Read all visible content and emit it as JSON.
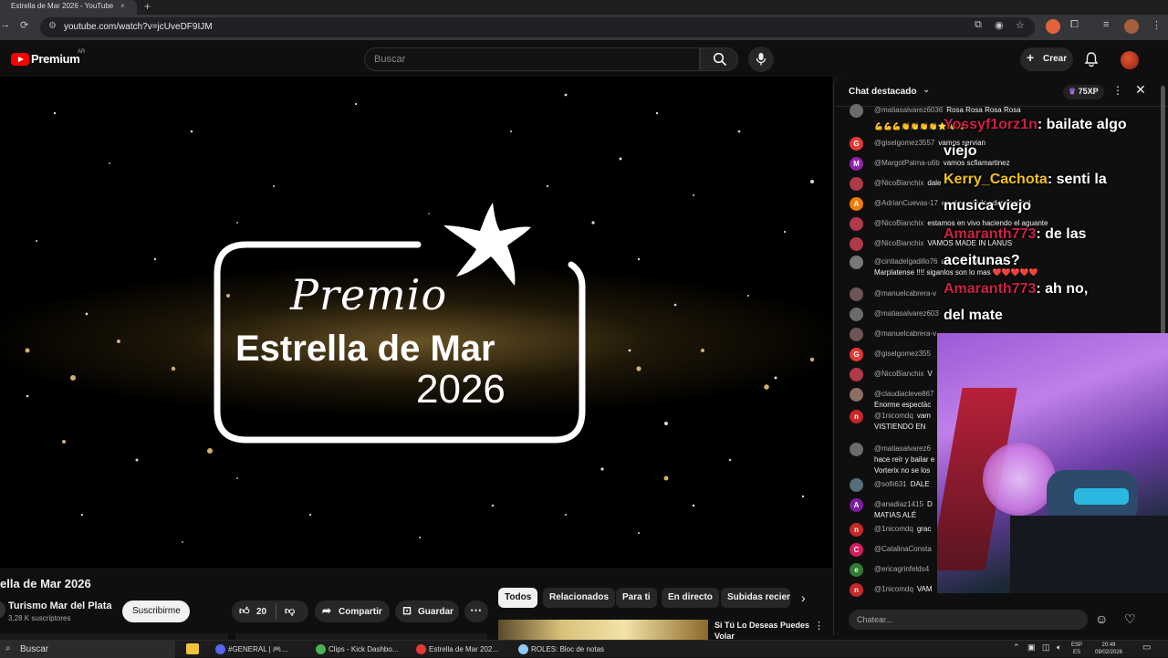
{
  "browser": {
    "tab_title": "Estrella de Mar 2026 - YouTube",
    "tab_close": "×",
    "new_tab": "+",
    "url": "youtube.com/watch?v=jcUveDF9IJM"
  },
  "masthead": {
    "brand": "Premium",
    "country": "AR",
    "search_placeholder": "Buscar",
    "create_label": "Crear"
  },
  "video": {
    "poster": {
      "premio": "Premio",
      "estrella": "Estrella de Mar",
      "year": "2026"
    },
    "title": "ella de Mar 2026",
    "channel": "Turismo Mar del Plata",
    "subscribers": "3,28 K suscriptores",
    "subscribe_label": "Suscribirme",
    "likes": "20",
    "share_label": "Compartir",
    "save_label": "Guardar"
  },
  "chips": [
    "Todos",
    "Relacionados",
    "Para ti",
    "En directo",
    "Subidas recien"
  ],
  "related": {
    "title_line1": "Si Tú Lo Deseas Puedes",
    "title_line2": "Volar"
  },
  "chat": {
    "title": "Chat destacado",
    "xp": "75XP",
    "input_placeholder": "Chatear...",
    "messages": [
      {
        "author": "@matiasalvarez6036",
        "text": "Rosa Rosa Rosa Rosa",
        "initial": "",
        "color": "#6b6b6b"
      },
      {
        "author": "",
        "text": "💪💪💪👏👏👏👏⭐⭐⭐",
        "initial": "",
        "color": "#0f0f0f"
      },
      {
        "author": "@giselgomez3557",
        "text": "vamos servian",
        "initial": "G",
        "color": "#e53935"
      },
      {
        "author": "@MargotPalma-u6b",
        "text": "vamos scfiamartinez",
        "initial": "M",
        "color": "#8e24aa"
      },
      {
        "author": "@NicoBianchix",
        "text": "dale",
        "initial": "",
        "color": "#b03a48"
      },
      {
        "author": "@AdrianCuevas-17",
        "text": "en vivo a todos dominados!",
        "initial": "A",
        "color": "#f57c00"
      },
      {
        "author": "@NicoBianchix",
        "text": "estamos en vivo haciendo el aguante",
        "initial": "",
        "color": "#b03a48"
      },
      {
        "author": "@NicoBianchix",
        "text": "VAMOS MADE IN LANUS",
        "initial": "",
        "color": "#b03a48"
      },
      {
        "author": "@cintiadelgadillo76",
        "text": "armona con Música",
        "initial": "",
        "color": "#777777"
      },
      {
        "author": "",
        "text": "Marplatense !!!! siganlos son lo mas ❤️❤️❤️❤️❤️",
        "initial": "",
        "color": "#0f0f0f"
      },
      {
        "author": "@manuelcabrera-v",
        "text": "",
        "initial": "",
        "color": "#6d5555"
      },
      {
        "author": "@matiasalvarez603",
        "text": "",
        "initial": "",
        "color": "#6b6b6b"
      },
      {
        "author": "@manuelcabrera-v",
        "text": "",
        "initial": "",
        "color": "#6d5555"
      },
      {
        "author": "@giselgomez355",
        "text": "",
        "initial": "G",
        "color": "#e53935"
      },
      {
        "author": "@NicoBianchix",
        "text": "V",
        "initial": "",
        "color": "#b03a48"
      },
      {
        "author": "@claudiacleve867",
        "text": "",
        "initial": "",
        "color": "#8d6e63"
      },
      {
        "author": "",
        "text": "Enorme espectác",
        "initial": "",
        "color": "#0f0f0f"
      },
      {
        "author": "@1nicomdq",
        "text": "vam",
        "initial": "n",
        "color": "#c62828"
      },
      {
        "author": "",
        "text": "VISTIENDO EN",
        "initial": "",
        "color": "#0f0f0f"
      },
      {
        "author": "@matiasalvarez6",
        "text": "",
        "initial": "",
        "color": "#6b6b6b"
      },
      {
        "author": "",
        "text": "hace reír y bailar e",
        "initial": "",
        "color": "#0f0f0f"
      },
      {
        "author": "",
        "text": "Vorterix no se los",
        "initial": "",
        "color": "#0f0f0f"
      },
      {
        "author": "@sofii631",
        "text": "DALE",
        "initial": "",
        "color": "#546e7a"
      },
      {
        "author": "@anadiaz1415",
        "text": "D",
        "initial": "A",
        "color": "#7b1fa2"
      },
      {
        "author": "",
        "text": "MATIAS ALÉ",
        "initial": "",
        "color": "#0f0f0f"
      },
      {
        "author": "@1nicomdq",
        "text": "grac",
        "initial": "n",
        "color": "#c62828"
      },
      {
        "author": "@CatalinaConsta",
        "text": "",
        "initial": "C",
        "color": "#d81b60"
      },
      {
        "author": "@ericagrinfelds4",
        "text": "",
        "initial": "e",
        "color": "#2e7d32"
      },
      {
        "author": "@1nicomdq",
        "text": "VAM",
        "initial": "n",
        "color": "#c62828"
      }
    ],
    "overlay": [
      {
        "name": "Yossyf1orz1n",
        "text": ": bailate algo",
        "cls": "n1"
      },
      {
        "name": "",
        "text": "viejo",
        "cls": ""
      },
      {
        "name": "Kerry_Cachota",
        "text": ": senti la",
        "cls": "n2"
      },
      {
        "name": "",
        "text": "musica viejo",
        "cls": ""
      },
      {
        "name": "Amaranth773",
        "text": ": de las",
        "cls": "n1"
      },
      {
        "name": "",
        "text": "aceitunas?",
        "cls": ""
      },
      {
        "name": "Amaranth773",
        "text": ": ah no,",
        "cls": "n1"
      },
      {
        "name": "",
        "text": "del mate",
        "cls": ""
      }
    ]
  },
  "taskbar": {
    "search": "Buscar",
    "apps": [
      {
        "label": "#GENERAL | 🎮...",
        "color": "#5865f2"
      },
      {
        "label": "Clips - Kick Dashbo...",
        "color": "#4caf50"
      },
      {
        "label": "Estrella de Mar 202...",
        "color": "#e53935"
      },
      {
        "label": "ROLES: Bloc de notas",
        "color": "#90caf9"
      }
    ],
    "lang_top": "ESP",
    "lang_bottom": "ES",
    "time": "20:49",
    "date": "09/02/2026"
  }
}
